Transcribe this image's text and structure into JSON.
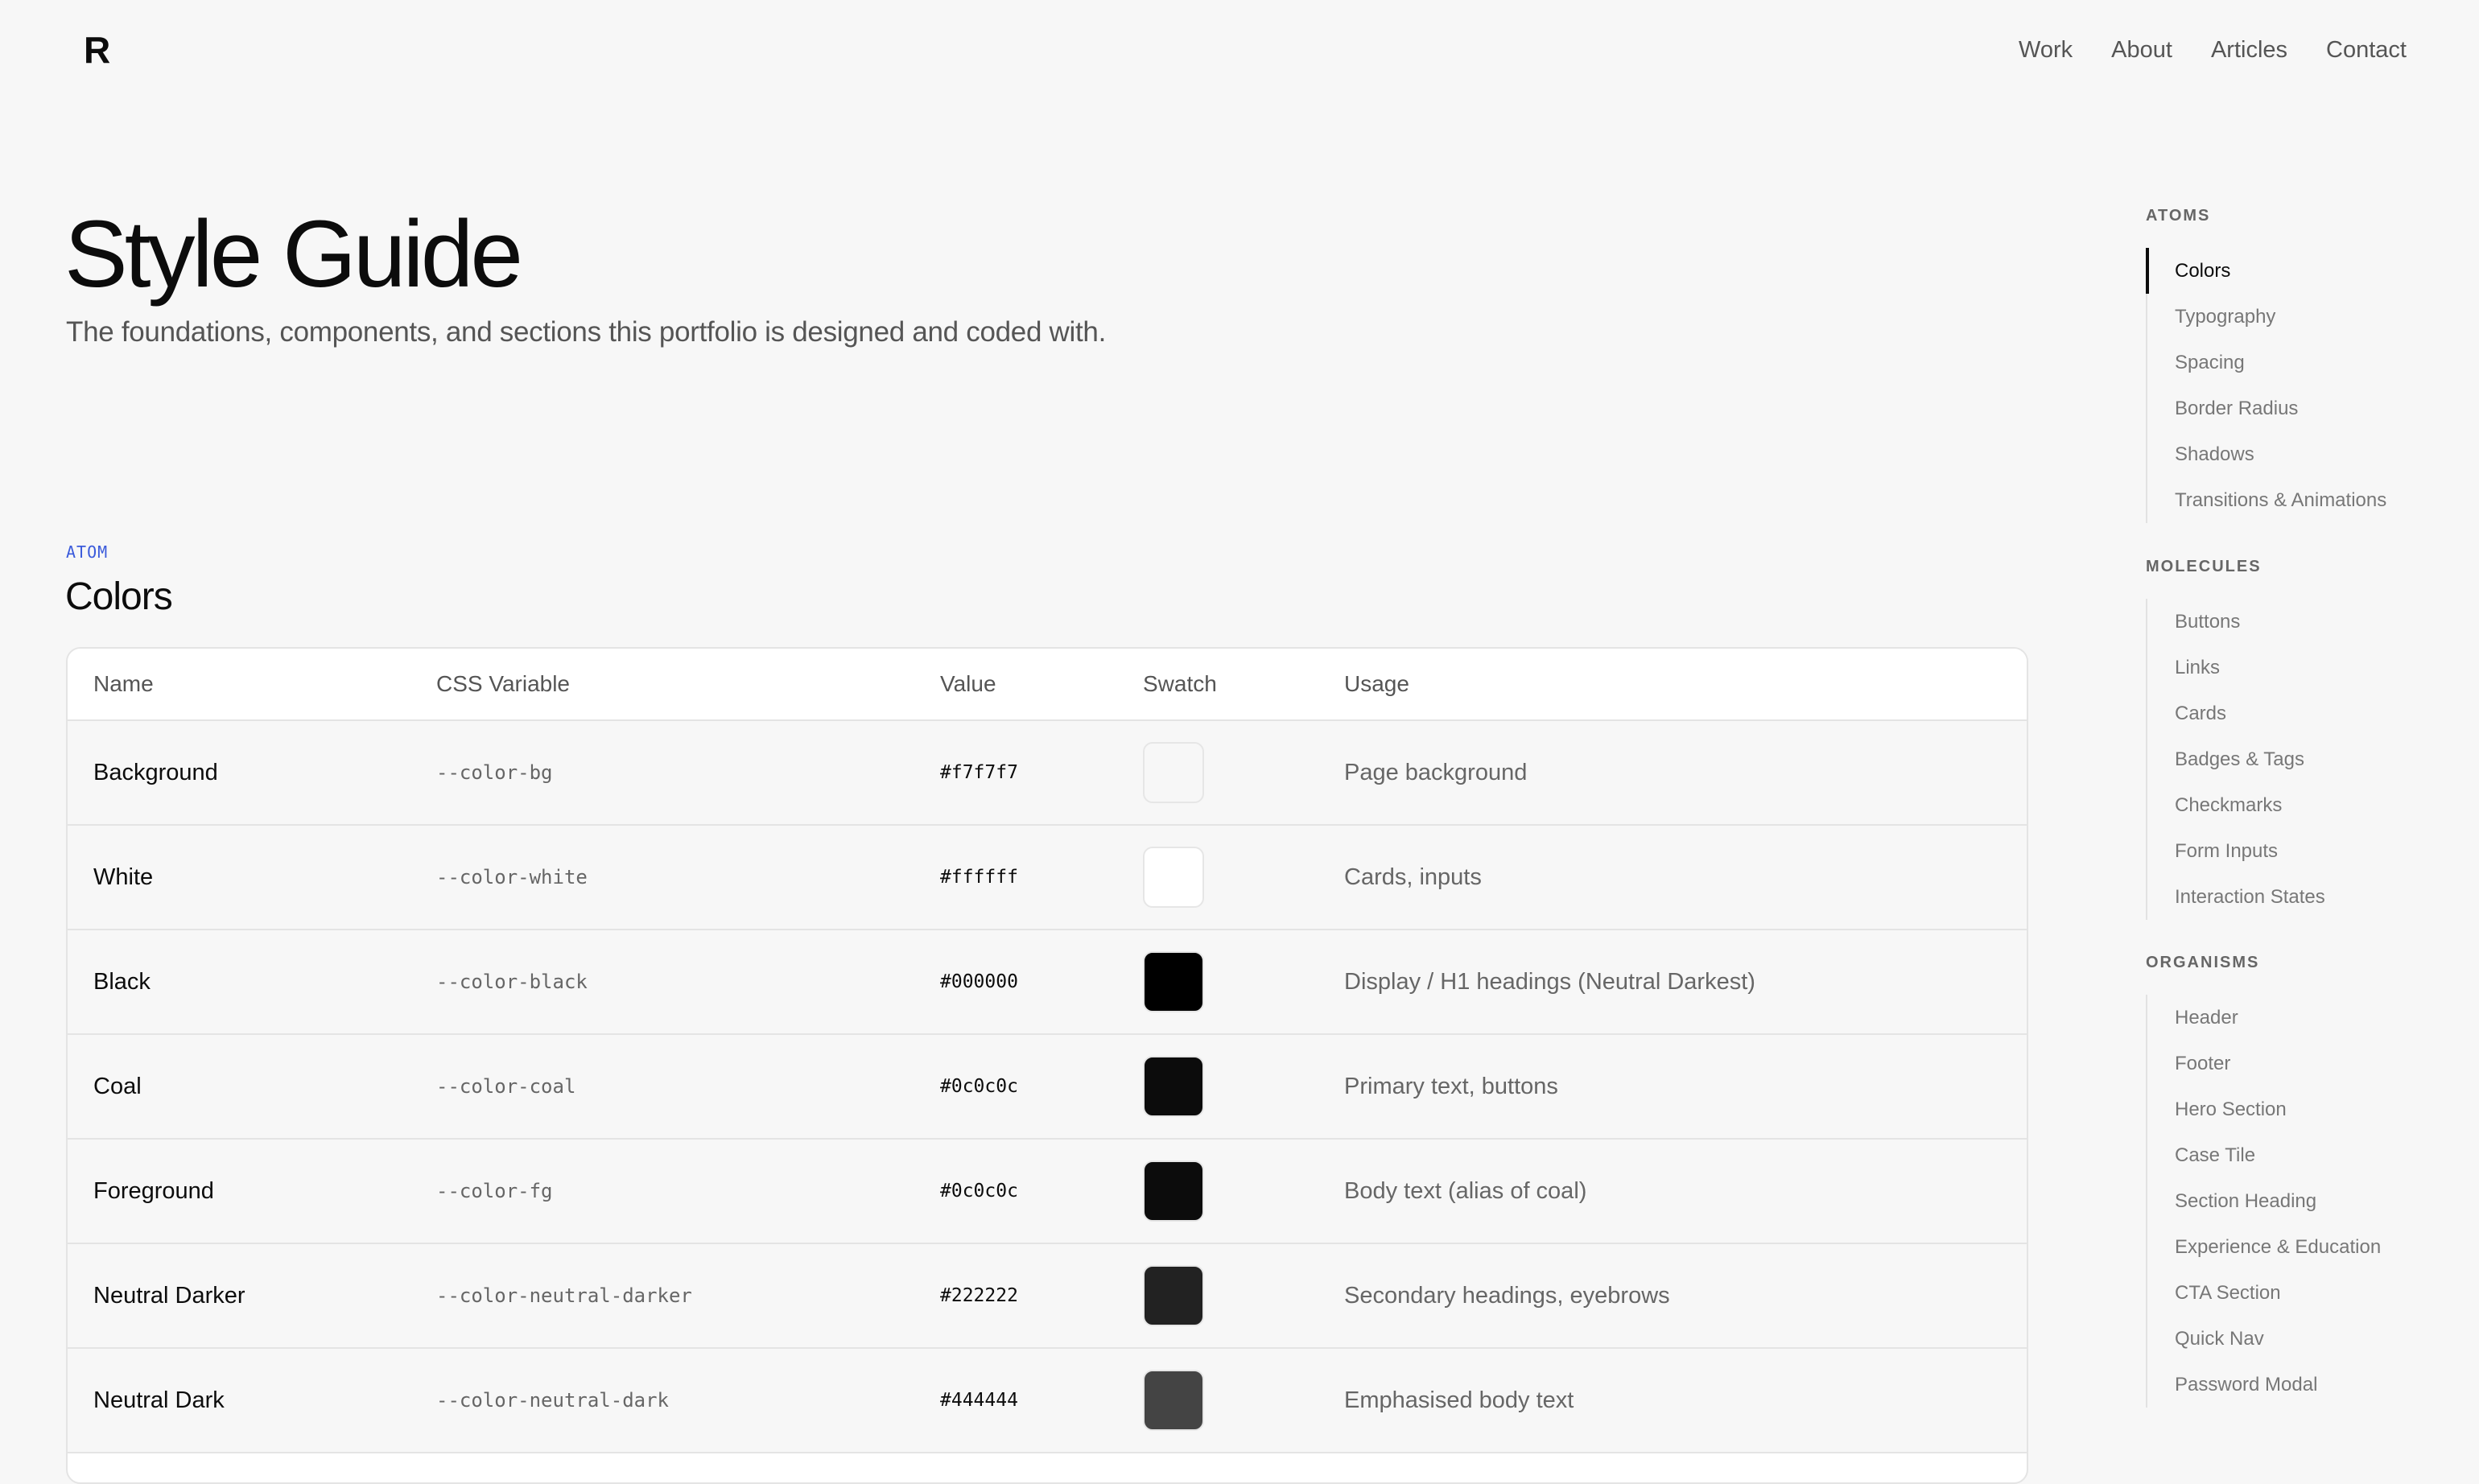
{
  "header": {
    "logo": "R",
    "nav": [
      "Work",
      "About",
      "Articles",
      "Contact"
    ]
  },
  "hero": {
    "title": "Style Guide",
    "subtitle": "The foundations, components, and sections this portfolio is designed and coded with."
  },
  "section": {
    "eyebrow": "ATOM",
    "title": "Colors"
  },
  "table": {
    "headers": [
      "Name",
      "CSS Variable",
      "Value",
      "Swatch",
      "Usage"
    ],
    "rows": [
      {
        "name": "Background",
        "variable": "--color-bg",
        "value": "#f7f7f7",
        "usage": "Page background"
      },
      {
        "name": "White",
        "variable": "--color-white",
        "value": "#ffffff",
        "usage": "Cards, inputs"
      },
      {
        "name": "Black",
        "variable": "--color-black",
        "value": "#000000",
        "usage": "Display / H1 headings (Neutral Darkest)"
      },
      {
        "name": "Coal",
        "variable": "--color-coal",
        "value": "#0c0c0c",
        "usage": "Primary text, buttons"
      },
      {
        "name": "Foreground",
        "variable": "--color-fg",
        "value": "#0c0c0c",
        "usage": "Body text (alias of coal)"
      },
      {
        "name": "Neutral Darker",
        "variable": "--color-neutral-darker",
        "value": "#222222",
        "usage": "Secondary headings, eyebrows"
      },
      {
        "name": "Neutral Dark",
        "variable": "--color-neutral-dark",
        "value": "#444444",
        "usage": "Emphasised body text"
      }
    ]
  },
  "sidebar": {
    "groups": [
      {
        "heading": "ATOMS",
        "items": [
          "Colors",
          "Typography",
          "Spacing",
          "Border Radius",
          "Shadows",
          "Transitions & Animations"
        ],
        "active": 0
      },
      {
        "heading": "MOLECULES",
        "items": [
          "Buttons",
          "Links",
          "Cards",
          "Badges & Tags",
          "Checkmarks",
          "Form Inputs",
          "Interaction States"
        ]
      },
      {
        "heading": "ORGANISMS",
        "items": [
          "Header",
          "Footer",
          "Hero Section",
          "Case Tile",
          "Section Heading",
          "Experience & Education",
          "CTA Section",
          "Quick Nav",
          "Password Modal"
        ]
      }
    ]
  },
  "colors": {
    "accent": "#3b5bdb",
    "background": "#f7f7f7",
    "text": "#0c0c0c"
  }
}
